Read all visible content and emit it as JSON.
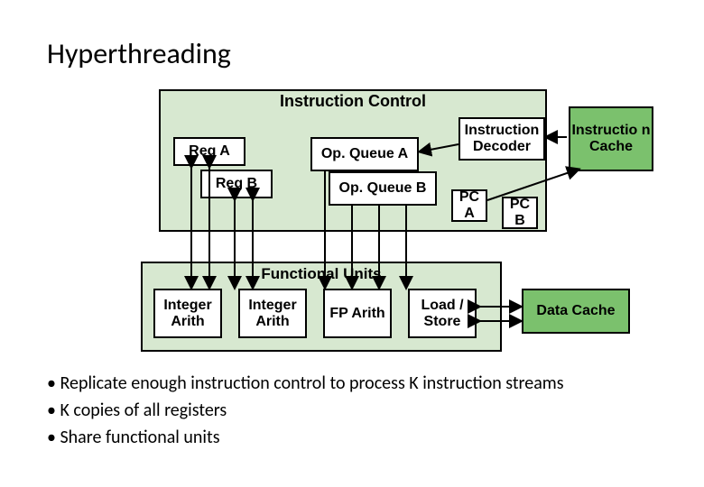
{
  "title": "Hyperthreading",
  "instruction_control": {
    "title": "Instruction Control",
    "reg_a": "Reg A",
    "reg_b": "Reg B",
    "opq_a": "Op. Queue A",
    "opq_b": "Op. Queue B",
    "decoder": "Instruction Decoder",
    "pc_a": "PC A",
    "pc_b": "PC B"
  },
  "instruction_cache": "Instructio n Cache",
  "functional_units": {
    "title": "Functional Units",
    "units": [
      "Integer Arith",
      "Integer Arith",
      "FP Arith",
      "Load / Store"
    ]
  },
  "data_cache": "Data Cache",
  "bullets": [
    "Replicate enough instruction control to process K instruction streams",
    "K copies of all registers",
    "Share functional units"
  ],
  "colors": {
    "light_green": "#d7e8d0",
    "dark_green": "#7bc16d"
  }
}
